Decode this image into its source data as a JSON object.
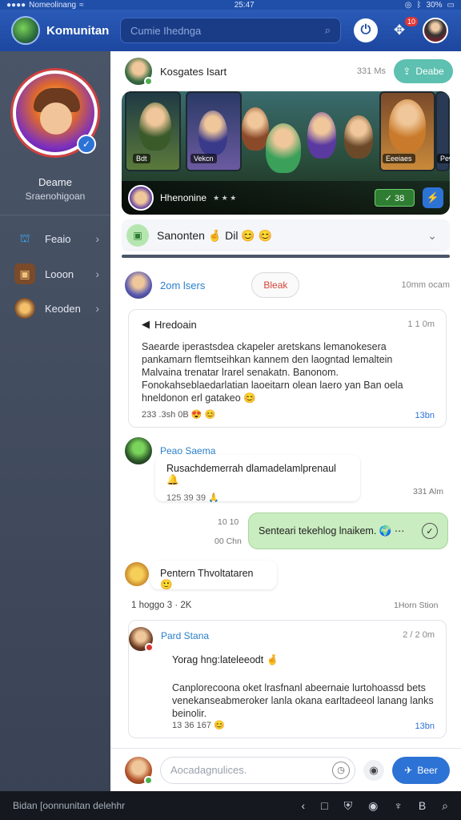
{
  "status": {
    "carrier": "Nomeolinang",
    "time": "25:47",
    "battery": "30%"
  },
  "header": {
    "title": "Komunitan",
    "search_placeholder": "Cumie Ihednga",
    "badge": "10"
  },
  "profile": {
    "name": "Deame",
    "status": "Sraenohigoan"
  },
  "sidebar": {
    "items": [
      {
        "label": "Feaio",
        "icon": "people-icon"
      },
      {
        "label": "Looon",
        "icon": "chest-icon"
      },
      {
        "label": "Keoden",
        "icon": "clan-icon"
      }
    ]
  },
  "post": {
    "title": "Kosgates Isart",
    "meta": "331 Ms",
    "share_label": "Deabe",
    "banner": {
      "tags": [
        "Bdt",
        "Vekcn",
        "Eeeiaes",
        "Pew"
      ],
      "author": "Hhenonine",
      "stars": "★ ★ ★",
      "count": "✓ 38"
    },
    "reaction_text": "Sanonten 🤞 Dil 😊 😊"
  },
  "group": {
    "name": "2om lsers",
    "block_label": "Bleak",
    "meta": "10mm ocam"
  },
  "announcement": {
    "title": "Hredoain",
    "meta": "1 1 0m",
    "lines": [
      "Saearde iperastsdea ckapeler aretskans lemanokesera",
      "pankamarn flemtseihkan kannem den laogntad lemaltein",
      "Malvaina trenatar lrarel senakatn. Banonom.",
      "Fonokahseblaedarlatian laoeitarn olean laero yan Ban oela",
      "hneldonon erl gatakeo 😊"
    ],
    "footer": "233 .3sh 0B 😍 😊",
    "link": "13bn"
  },
  "messages": [
    {
      "author": "Peao Saema",
      "text": "Rusachdemerrah dlamadelamlprenaul 🔔",
      "meta": "125 39 39 🙏",
      "time": "331 Alm"
    },
    {
      "out_text": "Senteari tekehlog lnaikem. 🌍 ⋯",
      "out_time1": "10 10",
      "out_time2": "00 Chn"
    },
    {
      "text": "Pentern Thvoltataren 🙂",
      "day_label": "1 hoggo 3 ·  2K",
      "day_time": "1Horn Stion"
    }
  ],
  "reply": {
    "author": "Pard Stana",
    "meta": "2 / 2 0m",
    "title": "Yorag hng:lateleeodt 🤞",
    "lines": [
      "Canplorecoona oket lrasfnanl abeernaie lurtohoassd bets",
      "venekanseabmeroker lanla okana earltadeeol lanang lanks",
      "beinolir."
    ],
    "footer": "13 36 167 😊",
    "link": "13bn"
  },
  "composer": {
    "placeholder": "Aocadagnulices.",
    "send_label": "Beer"
  },
  "sysbar": {
    "text": "Bidan [oonnunitan delehhr"
  },
  "colors": {
    "brand": "#1f4fa8",
    "accent": "#2d73d6",
    "sidebar": "#4a5568",
    "share": "#5dc0b0"
  }
}
